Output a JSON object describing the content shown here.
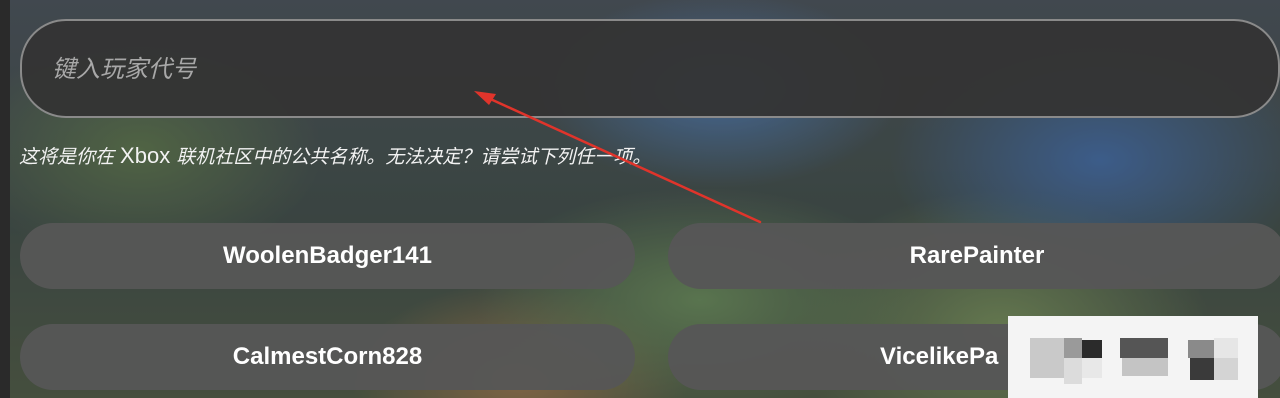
{
  "gamertag": {
    "placeholder": "键入玩家代号",
    "value": ""
  },
  "hint": {
    "before": "这将是你在 ",
    "brand": "Xbox",
    "after": " 联机社区中的公共名称。无法决定？请尝试下列任一项。"
  },
  "suggestions": [
    "WoolenBadger141",
    "RarePainter",
    "CalmestCorn828",
    "VicelikePa"
  ],
  "colors": {
    "arrow": "#e0342b",
    "button": "#565656",
    "input_border": "#8a8a8a"
  }
}
